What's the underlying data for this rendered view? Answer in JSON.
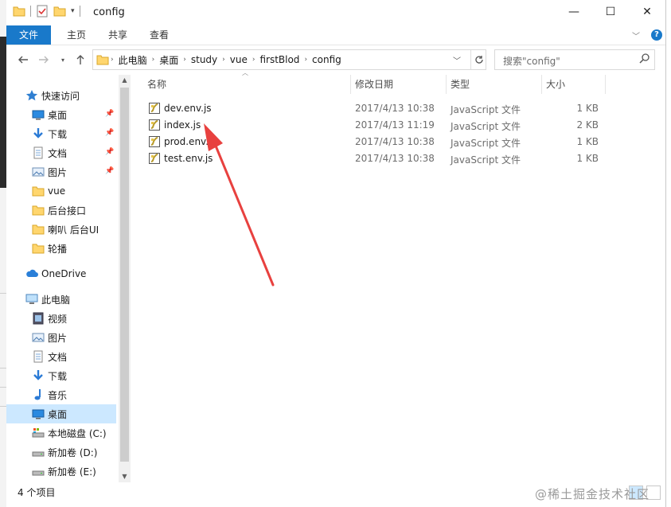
{
  "window": {
    "title": "config",
    "controls": {
      "minimize": "—",
      "maximize": "☐",
      "close": "✕"
    }
  },
  "ribbon": {
    "tabs": [
      "文件",
      "主页",
      "共享",
      "查看"
    ]
  },
  "address": {
    "crumbs": [
      "此电脑",
      "桌面",
      "study",
      "vue",
      "firstBlod",
      "config"
    ]
  },
  "search": {
    "placeholder": "搜索\"config\""
  },
  "nav": {
    "quick_access": "快速访问",
    "quick_items": [
      {
        "label": "桌面",
        "icon": "desktop-icon",
        "pinned": true
      },
      {
        "label": "下载",
        "icon": "download-icon",
        "pinned": true
      },
      {
        "label": "文档",
        "icon": "document-icon",
        "pinned": true
      },
      {
        "label": "图片",
        "icon": "picture-icon",
        "pinned": true
      },
      {
        "label": "vue",
        "icon": "folder-icon",
        "pinned": false
      },
      {
        "label": "后台接口",
        "icon": "folder-icon",
        "pinned": false
      },
      {
        "label": "喇叭 后台UI",
        "icon": "folder-icon",
        "pinned": false
      },
      {
        "label": "轮播",
        "icon": "folder-icon",
        "pinned": false
      }
    ],
    "onedrive": "OneDrive",
    "this_pc": "此电脑",
    "pc_items": [
      {
        "label": "视频",
        "icon": "video-icon"
      },
      {
        "label": "图片",
        "icon": "picture-icon"
      },
      {
        "label": "文档",
        "icon": "document-icon"
      },
      {
        "label": "下载",
        "icon": "download-icon"
      },
      {
        "label": "音乐",
        "icon": "music-icon"
      },
      {
        "label": "桌面",
        "icon": "desktop-icon",
        "selected": true
      },
      {
        "label": "本地磁盘 (C:)",
        "icon": "drive-c-icon"
      },
      {
        "label": "新加卷 (D:)",
        "icon": "drive-icon"
      },
      {
        "label": "新加卷 (E:)",
        "icon": "drive-icon"
      }
    ]
  },
  "list": {
    "columns": [
      "名称",
      "修改日期",
      "类型",
      "大小"
    ],
    "files": [
      {
        "name": "dev.env.js",
        "date": "2017/4/13 10:38",
        "type": "JavaScript 文件",
        "size": "1 KB"
      },
      {
        "name": "index.js",
        "date": "2017/4/13 11:19",
        "type": "JavaScript 文件",
        "size": "2 KB"
      },
      {
        "name": "prod.env.js",
        "date": "2017/4/13 10:38",
        "type": "JavaScript 文件",
        "size": "1 KB"
      },
      {
        "name": "test.env.js",
        "date": "2017/4/13 10:38",
        "type": "JavaScript 文件",
        "size": "1 KB"
      }
    ]
  },
  "status": {
    "count": "4 个项目"
  },
  "watermark": "@稀土掘金技术社区",
  "colors": {
    "accent": "#1979ca",
    "selection": "#cce8ff",
    "arrow": "#e8413f",
    "folder": "#ffd66e"
  }
}
